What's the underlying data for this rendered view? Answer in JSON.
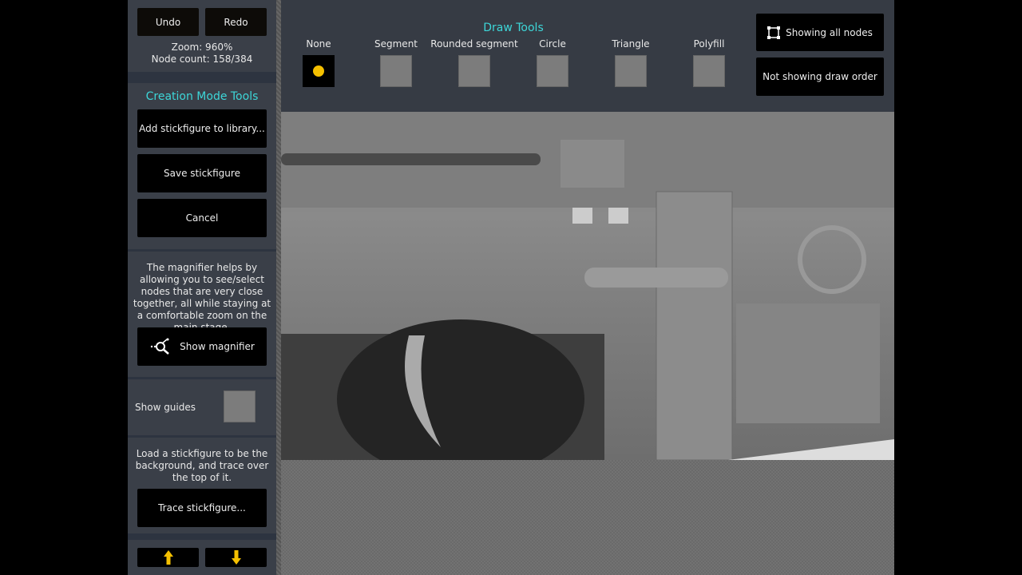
{
  "sidebar": {
    "undo": "Undo",
    "redo": "Redo",
    "zoom": "Zoom: 960%",
    "node_count": "Node count: 158/384",
    "section_title": "Creation Mode Tools",
    "add_library": "Add stickfigure to library...",
    "save": "Save stickfigure",
    "cancel": "Cancel",
    "magnifier_help": "The magnifier helps by allowing you to see/select nodes that are very close together, all while staying at a comfortable zoom on the main stage.",
    "show_magnifier": "Show magnifier",
    "show_guides": "Show guides",
    "show_guides_checked": false,
    "trace_help": "Load a stickfigure to be the background, and trace over the top of it.",
    "trace": "Trace stickfigure...",
    "up_icon": "arrow-up",
    "down_icon": "arrow-down"
  },
  "draw_tools": {
    "title": "Draw Tools",
    "selected": "None",
    "tools": [
      {
        "label": "None"
      },
      {
        "label": "Segment"
      },
      {
        "label": "Rounded segment"
      },
      {
        "label": "Circle"
      },
      {
        "label": "Triangle"
      },
      {
        "label": "Polyfill"
      }
    ]
  },
  "toggles": {
    "nodes": "Showing all nodes",
    "draw_order": "Not showing draw order"
  },
  "colors": {
    "accent": "#3dd6d8",
    "selected_dot": "#f5c000",
    "arrow": "#f5c000"
  }
}
